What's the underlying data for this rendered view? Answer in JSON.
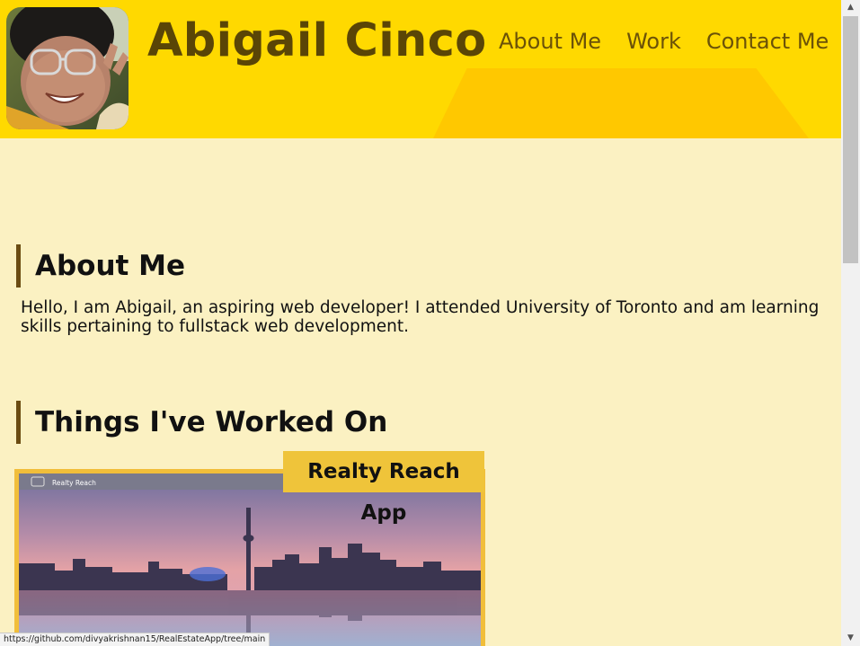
{
  "header": {
    "site_title": "Abigail Cinco",
    "avatar_alt": "avatar",
    "nav": [
      {
        "label": "About Me"
      },
      {
        "label": "Work"
      },
      {
        "label": "Contact Me"
      }
    ]
  },
  "about": {
    "heading": "About Me",
    "text": "Hello, I am Abigail, an aspiring web developer! I attended University of Toronto and am learning skills pertaining to fullstack web development."
  },
  "work": {
    "heading": "Things I've Worked On",
    "projects": [
      {
        "title": "Realty Reach App",
        "screenshot_brand": "Realty Reach"
      }
    ]
  },
  "status_bar": {
    "url": "https://github.com/divyakrishnan15/RealEstateApp/tree/main"
  },
  "colors": {
    "header_bg": "#ffd900",
    "page_bg": "#fbf1c2",
    "title_color": "#5a4506",
    "accent": "#efc43a"
  }
}
